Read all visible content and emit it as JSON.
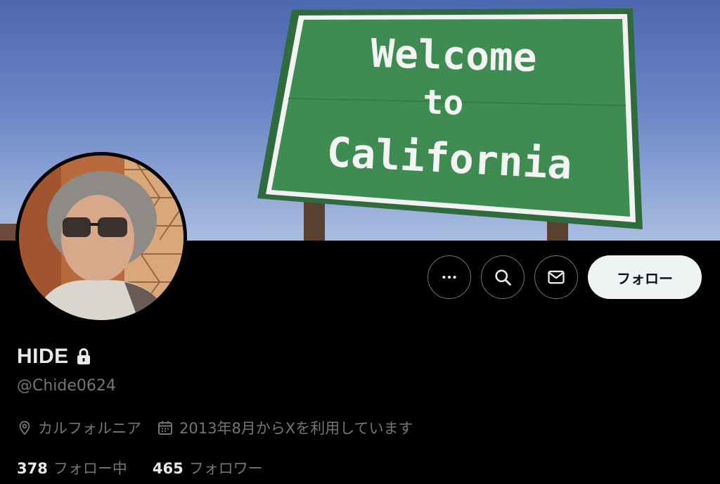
{
  "banner": {
    "sign_lines": [
      "Welcome",
      "to",
      "California"
    ]
  },
  "actions": {
    "more_icon": "more-dots-icon",
    "search_icon": "search-icon",
    "message_icon": "envelope-icon",
    "follow_label": "フォロー"
  },
  "profile": {
    "display_name": "HIDE",
    "protected_icon": "lock-icon",
    "handle": "@Chide0624",
    "location": "カルフォルニア",
    "joined": "2013年8月からXを利用しています"
  },
  "stats": {
    "following_count": "378",
    "following_label": "フォロー中",
    "followers_count": "465",
    "followers_label": "フォロワー"
  },
  "colors": {
    "background": "#000000",
    "text_primary": "#e7e9ea",
    "text_secondary": "#71767b",
    "sign_green": "#3a8a4f",
    "follow_button_bg": "#eff3f4"
  }
}
